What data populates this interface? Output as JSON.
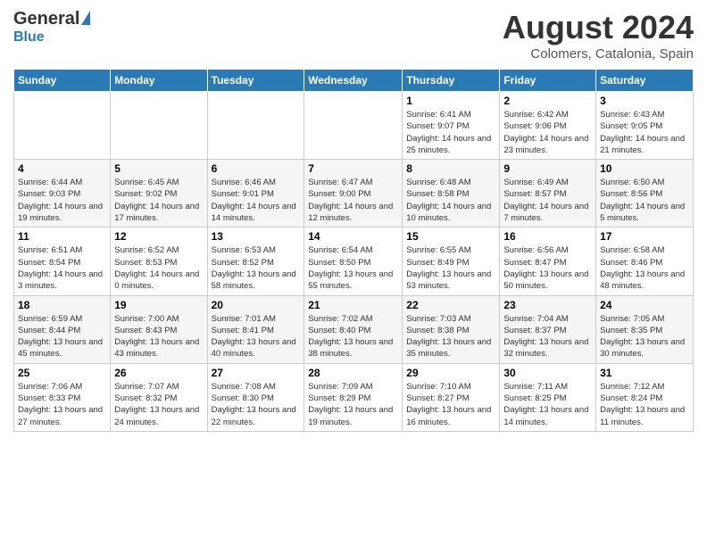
{
  "header": {
    "logo_general": "General",
    "logo_blue": "Blue",
    "month_title": "August 2024",
    "location": "Colomers, Catalonia, Spain"
  },
  "weekdays": [
    "Sunday",
    "Monday",
    "Tuesday",
    "Wednesday",
    "Thursday",
    "Friday",
    "Saturday"
  ],
  "weeks": [
    [
      {
        "day": "",
        "info": ""
      },
      {
        "day": "",
        "info": ""
      },
      {
        "day": "",
        "info": ""
      },
      {
        "day": "",
        "info": ""
      },
      {
        "day": "1",
        "info": "Sunrise: 6:41 AM\nSunset: 9:07 PM\nDaylight: 14 hours and 25 minutes."
      },
      {
        "day": "2",
        "info": "Sunrise: 6:42 AM\nSunset: 9:06 PM\nDaylight: 14 hours and 23 minutes."
      },
      {
        "day": "3",
        "info": "Sunrise: 6:43 AM\nSunset: 9:05 PM\nDaylight: 14 hours and 21 minutes."
      }
    ],
    [
      {
        "day": "4",
        "info": "Sunrise: 6:44 AM\nSunset: 9:03 PM\nDaylight: 14 hours and 19 minutes."
      },
      {
        "day": "5",
        "info": "Sunrise: 6:45 AM\nSunset: 9:02 PM\nDaylight: 14 hours and 17 minutes."
      },
      {
        "day": "6",
        "info": "Sunrise: 6:46 AM\nSunset: 9:01 PM\nDaylight: 14 hours and 14 minutes."
      },
      {
        "day": "7",
        "info": "Sunrise: 6:47 AM\nSunset: 9:00 PM\nDaylight: 14 hours and 12 minutes."
      },
      {
        "day": "8",
        "info": "Sunrise: 6:48 AM\nSunset: 8:58 PM\nDaylight: 14 hours and 10 minutes."
      },
      {
        "day": "9",
        "info": "Sunrise: 6:49 AM\nSunset: 8:57 PM\nDaylight: 14 hours and 7 minutes."
      },
      {
        "day": "10",
        "info": "Sunrise: 6:50 AM\nSunset: 8:56 PM\nDaylight: 14 hours and 5 minutes."
      }
    ],
    [
      {
        "day": "11",
        "info": "Sunrise: 6:51 AM\nSunset: 8:54 PM\nDaylight: 14 hours and 3 minutes."
      },
      {
        "day": "12",
        "info": "Sunrise: 6:52 AM\nSunset: 8:53 PM\nDaylight: 14 hours and 0 minutes."
      },
      {
        "day": "13",
        "info": "Sunrise: 6:53 AM\nSunset: 8:52 PM\nDaylight: 13 hours and 58 minutes."
      },
      {
        "day": "14",
        "info": "Sunrise: 6:54 AM\nSunset: 8:50 PM\nDaylight: 13 hours and 55 minutes."
      },
      {
        "day": "15",
        "info": "Sunrise: 6:55 AM\nSunset: 8:49 PM\nDaylight: 13 hours and 53 minutes."
      },
      {
        "day": "16",
        "info": "Sunrise: 6:56 AM\nSunset: 8:47 PM\nDaylight: 13 hours and 50 minutes."
      },
      {
        "day": "17",
        "info": "Sunrise: 6:58 AM\nSunset: 8:46 PM\nDaylight: 13 hours and 48 minutes."
      }
    ],
    [
      {
        "day": "18",
        "info": "Sunrise: 6:59 AM\nSunset: 8:44 PM\nDaylight: 13 hours and 45 minutes."
      },
      {
        "day": "19",
        "info": "Sunrise: 7:00 AM\nSunset: 8:43 PM\nDaylight: 13 hours and 43 minutes."
      },
      {
        "day": "20",
        "info": "Sunrise: 7:01 AM\nSunset: 8:41 PM\nDaylight: 13 hours and 40 minutes."
      },
      {
        "day": "21",
        "info": "Sunrise: 7:02 AM\nSunset: 8:40 PM\nDaylight: 13 hours and 38 minutes."
      },
      {
        "day": "22",
        "info": "Sunrise: 7:03 AM\nSunset: 8:38 PM\nDaylight: 13 hours and 35 minutes."
      },
      {
        "day": "23",
        "info": "Sunrise: 7:04 AM\nSunset: 8:37 PM\nDaylight: 13 hours and 32 minutes."
      },
      {
        "day": "24",
        "info": "Sunrise: 7:05 AM\nSunset: 8:35 PM\nDaylight: 13 hours and 30 minutes."
      }
    ],
    [
      {
        "day": "25",
        "info": "Sunrise: 7:06 AM\nSunset: 8:33 PM\nDaylight: 13 hours and 27 minutes."
      },
      {
        "day": "26",
        "info": "Sunrise: 7:07 AM\nSunset: 8:32 PM\nDaylight: 13 hours and 24 minutes."
      },
      {
        "day": "27",
        "info": "Sunrise: 7:08 AM\nSunset: 8:30 PM\nDaylight: 13 hours and 22 minutes."
      },
      {
        "day": "28",
        "info": "Sunrise: 7:09 AM\nSunset: 8:29 PM\nDaylight: 13 hours and 19 minutes."
      },
      {
        "day": "29",
        "info": "Sunrise: 7:10 AM\nSunset: 8:27 PM\nDaylight: 13 hours and 16 minutes."
      },
      {
        "day": "30",
        "info": "Sunrise: 7:11 AM\nSunset: 8:25 PM\nDaylight: 13 hours and 14 minutes."
      },
      {
        "day": "31",
        "info": "Sunrise: 7:12 AM\nSunset: 8:24 PM\nDaylight: 13 hours and 11 minutes."
      }
    ]
  ]
}
